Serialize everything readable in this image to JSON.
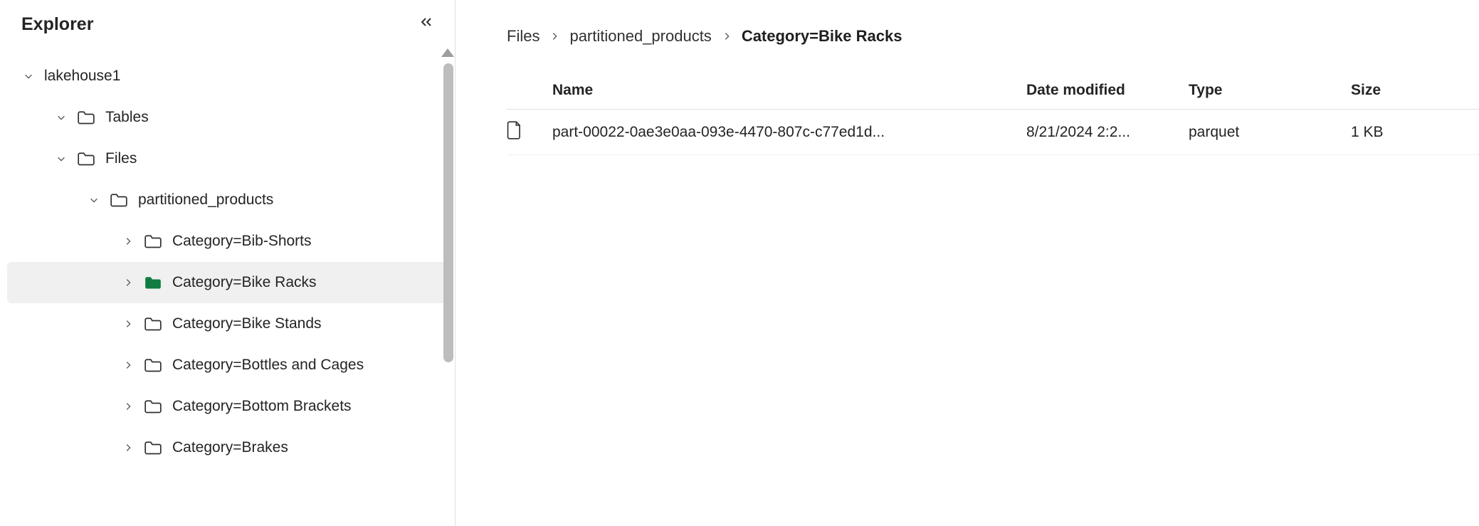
{
  "sidebar": {
    "title": "Explorer",
    "root": {
      "label": "lakehouse1",
      "children": [
        {
          "label": "Tables"
        },
        {
          "label": "Files",
          "children": [
            {
              "label": "partitioned_products",
              "children": [
                {
                  "label": "Category=Bib-Shorts",
                  "selected": false
                },
                {
                  "label": "Category=Bike Racks",
                  "selected": true
                },
                {
                  "label": "Category=Bike Stands",
                  "selected": false
                },
                {
                  "label": "Category=Bottles and Cages",
                  "selected": false
                },
                {
                  "label": "Category=Bottom Brackets",
                  "selected": false
                },
                {
                  "label": "Category=Brakes",
                  "selected": false
                }
              ]
            }
          ]
        }
      ]
    }
  },
  "breadcrumb": [
    {
      "label": "Files",
      "current": false
    },
    {
      "label": "partitioned_products",
      "current": false
    },
    {
      "label": "Category=Bike Racks",
      "current": true
    }
  ],
  "table": {
    "columns": [
      "Name",
      "Date modified",
      "Type",
      "Size"
    ],
    "rows": [
      {
        "name": "part-00022-0ae3e0aa-093e-4470-807c-c77ed1d...",
        "date": "8/21/2024 2:2...",
        "type": "parquet",
        "size": "1 KB"
      }
    ]
  }
}
